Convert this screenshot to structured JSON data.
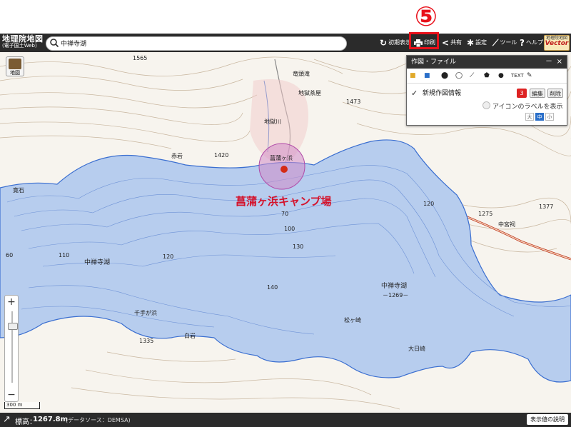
{
  "step_marker": "⑤",
  "header": {
    "logo_line1": "地理院地図",
    "logo_line2": "(電子国土Web)",
    "search_value": "中禅寺湖",
    "buttons": {
      "initial_view": "初期表示",
      "print": "印刷",
      "share": "共有",
      "settings": "設定",
      "tools": "ツール",
      "help": "ヘルプ"
    },
    "vector_logo_top": "地理院地図",
    "vector_logo_bottom": "Vector"
  },
  "map": {
    "layer_button_label": "地図",
    "camp_label": "菖蒲ヶ浜キャンプ場",
    "scale_label": "300 m",
    "labels": {
      "l1565": "1565",
      "ryuzunotaki": "竜頭滝",
      "jigokuchaya": "地獄茶屋",
      "l1473": "1473",
      "akaiwa": "赤岩",
      "l1420": "1420",
      "shobugahama": "菖蒲ヶ浜",
      "jigokugawa": "地獄川",
      "kanjiishi": "寛石",
      "depth70": "70",
      "depth100": "100",
      "depth130": "130",
      "depth110": "110",
      "depth120": "120",
      "depth60": "60",
      "depth140": "140",
      "route120": "120",
      "l1275": "1275",
      "l1377": "1377",
      "chugushi": "中宮祠",
      "lake_name_left": "中禅寺湖",
      "lake_name_right": "中禅寺湖",
      "lake_elev": "－1269－",
      "senjugahama": "千手が浜",
      "shiraiwa": "白岩",
      "l1335": "1335",
      "matsugasaki": "松ヶ崎",
      "ojirigasaki": "大日崎"
    }
  },
  "panel": {
    "title": "作図・ファイル",
    "minimize": "－",
    "close": "×",
    "text_tool": "TEXT",
    "layer_name": "新規作図情報",
    "count": "3",
    "edit": "編集",
    "delete": "削除",
    "label_toggle": "アイコンのラベルを表示",
    "size_large": "大",
    "size_medium": "中",
    "size_small": "小"
  },
  "status": {
    "elevation_label": "標高：",
    "elevation_value": "1267.8m",
    "source": "(データソース：DEMSA)",
    "explain_button": "表示値の説明"
  },
  "colors": {
    "accent_red": "#e8101a",
    "lake_blue": "#b7cdee",
    "toolbar_dark": "#2b2b2b"
  }
}
